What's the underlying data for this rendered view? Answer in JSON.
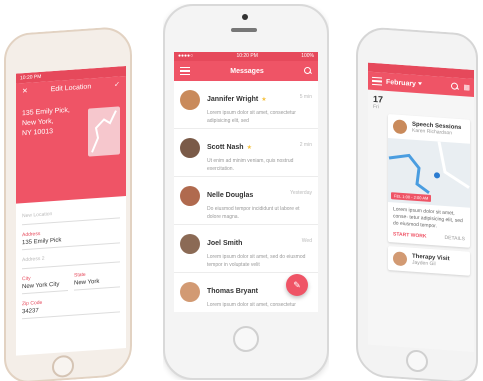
{
  "left_phone": {
    "status_time": "10:20 PM",
    "header": {
      "title": "Edit Location",
      "address_line1": "135 Emily Pick, New York,",
      "address_line2": "NY 10013"
    },
    "form": {
      "fields": [
        {
          "label": "New Location",
          "value": ""
        },
        {
          "label": "Address",
          "value": "135 Emily Pick"
        },
        {
          "label": "Address 2",
          "value": ""
        }
      ],
      "city": {
        "label": "City",
        "value": "New York City"
      },
      "state": {
        "label": "State",
        "value": "New York"
      },
      "zip": {
        "label": "Zip Code",
        "value": "34237"
      }
    }
  },
  "center_phone": {
    "status_time": "10:20 PM",
    "status_battery": "100%",
    "appbar": {
      "title": "Messages"
    },
    "messages": [
      {
        "name": "Jannifer Wright",
        "time": "5 min",
        "text": "Lorem ipsum dolor sit amet, consectetur adipisicing elit, sed",
        "starred": true,
        "avatar_color": "#c98a5b"
      },
      {
        "name": "Scott Nash",
        "time": "2 min",
        "text": "Ut enim ad minim veniam, quis nostrud exercitation.",
        "starred": true,
        "avatar_color": "#7a5a48"
      },
      {
        "name": "Nelle Douglas",
        "time": "Yesterday",
        "text": "Do eiusmod tempor incididunt ut labore et dolore magna.",
        "starred": false,
        "avatar_color": "#b06a4e"
      },
      {
        "name": "Joel Smith",
        "time": "Wed",
        "text": "Lorem ipsum dolor sit amet, sed do eiusmod tempor in voluptate velit",
        "starred": false,
        "avatar_color": "#8b6a55"
      },
      {
        "name": "Thomas Bryant",
        "time": "",
        "text": "Lorem ipsum dolor sit amet, consectetur",
        "starred": false,
        "avatar_color": "#d29a73"
      }
    ],
    "fab_icon": "edit-icon"
  },
  "right_phone": {
    "appbar": {
      "month": "February"
    },
    "day_number": "17",
    "day_name": "Fri",
    "cards": [
      {
        "title": "Speech Sessions",
        "subtitle": "Karen Richardson",
        "time_badge": "FEL 1:00 - 2:00 AM",
        "text": "Lorem ipsum dolor sit amet, conse- tetur adipisicing elit, sed do eiusmod tempor.",
        "action_primary": "START WORK",
        "action_secondary": "DETAILS"
      },
      {
        "title": "Therapy Visit",
        "subtitle": "Jayden Gil"
      }
    ]
  },
  "colors": {
    "accent": "#ef5466",
    "accent_dark": "#e6495b",
    "star": "#f5c241"
  }
}
